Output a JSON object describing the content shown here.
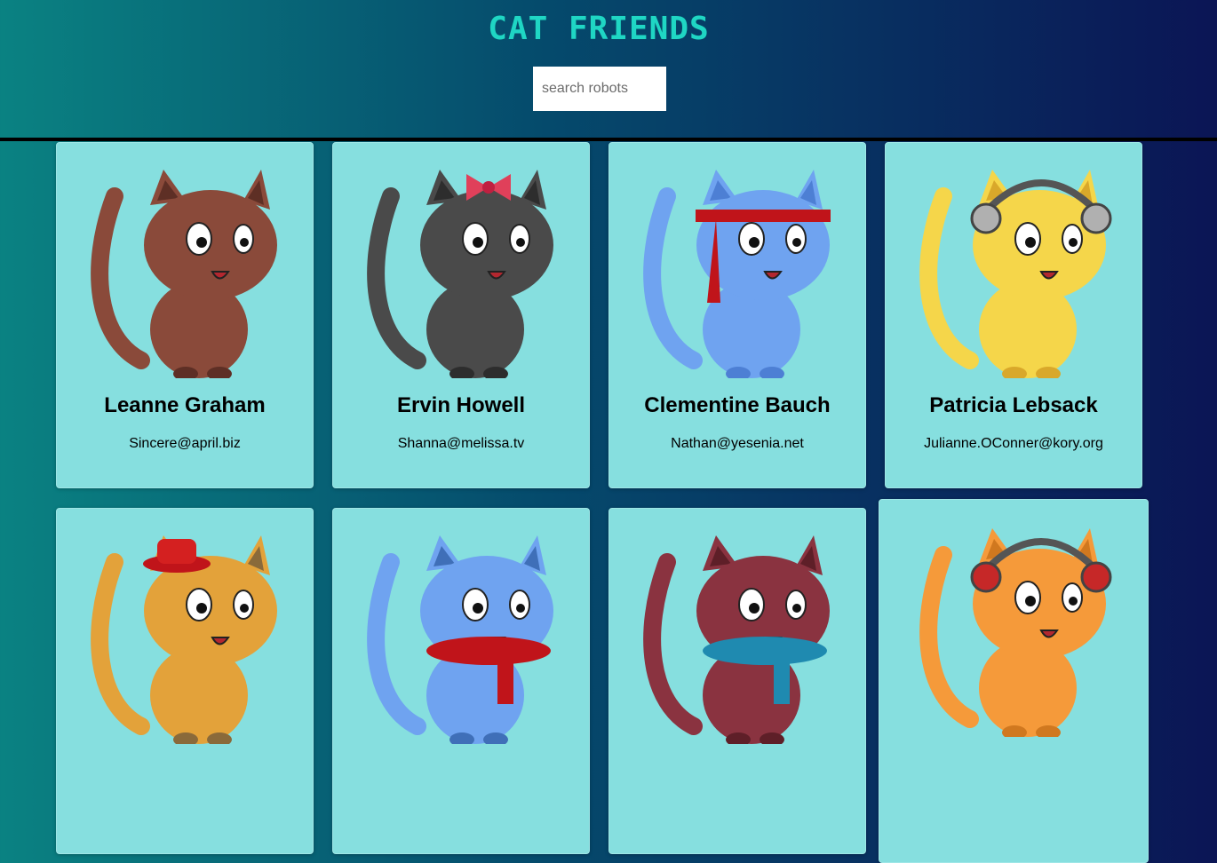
{
  "header": {
    "title": "CAT FRIENDS",
    "search_placeholder": "search robots"
  },
  "colors": {
    "title": "#1fd6c4",
    "card": "#86dfdf",
    "background_left": "#0a8282",
    "background_right": "#0b1555"
  },
  "cards": [
    {
      "name": "Leanne Graham",
      "email": "Sincere@april.biz",
      "cat": {
        "fur": "#8a4a3a",
        "accent": "#5e2f25",
        "accessory": "patched-ear"
      }
    },
    {
      "name": "Ervin Howell",
      "email": "Shanna@melissa.tv",
      "cat": {
        "fur": "#4a4a4a",
        "accent": "#2d2d2d",
        "accessory": "pink-bow"
      }
    },
    {
      "name": "Clementine Bauch",
      "email": "Nathan@yesenia.net",
      "cat": {
        "fur": "#6fa3f0",
        "accent": "#4d7fd4",
        "accessory": "red-headband"
      }
    },
    {
      "name": "Patricia Lebsack",
      "email": "Julianne.OConner@kory.org",
      "cat": {
        "fur": "#f5d64a",
        "accent": "#d9a82a",
        "accessory": "silver-headphones"
      }
    },
    {
      "name": "",
      "email": "",
      "cat": {
        "fur": "#e3a23a",
        "accent": "#8a6a3a",
        "accessory": "red-hat"
      }
    },
    {
      "name": "",
      "email": "",
      "cat": {
        "fur": "#6fa3f0",
        "accent": "#3f6fb8",
        "accessory": "red-scarf"
      }
    },
    {
      "name": "",
      "email": "",
      "cat": {
        "fur": "#8a3340",
        "accent": "#5e1f28",
        "accessory": "blue-scarf"
      }
    },
    {
      "name": "",
      "email": "",
      "cat": {
        "fur": "#f59a3a",
        "accent": "#d0781f",
        "accessory": "red-headphones"
      }
    }
  ]
}
